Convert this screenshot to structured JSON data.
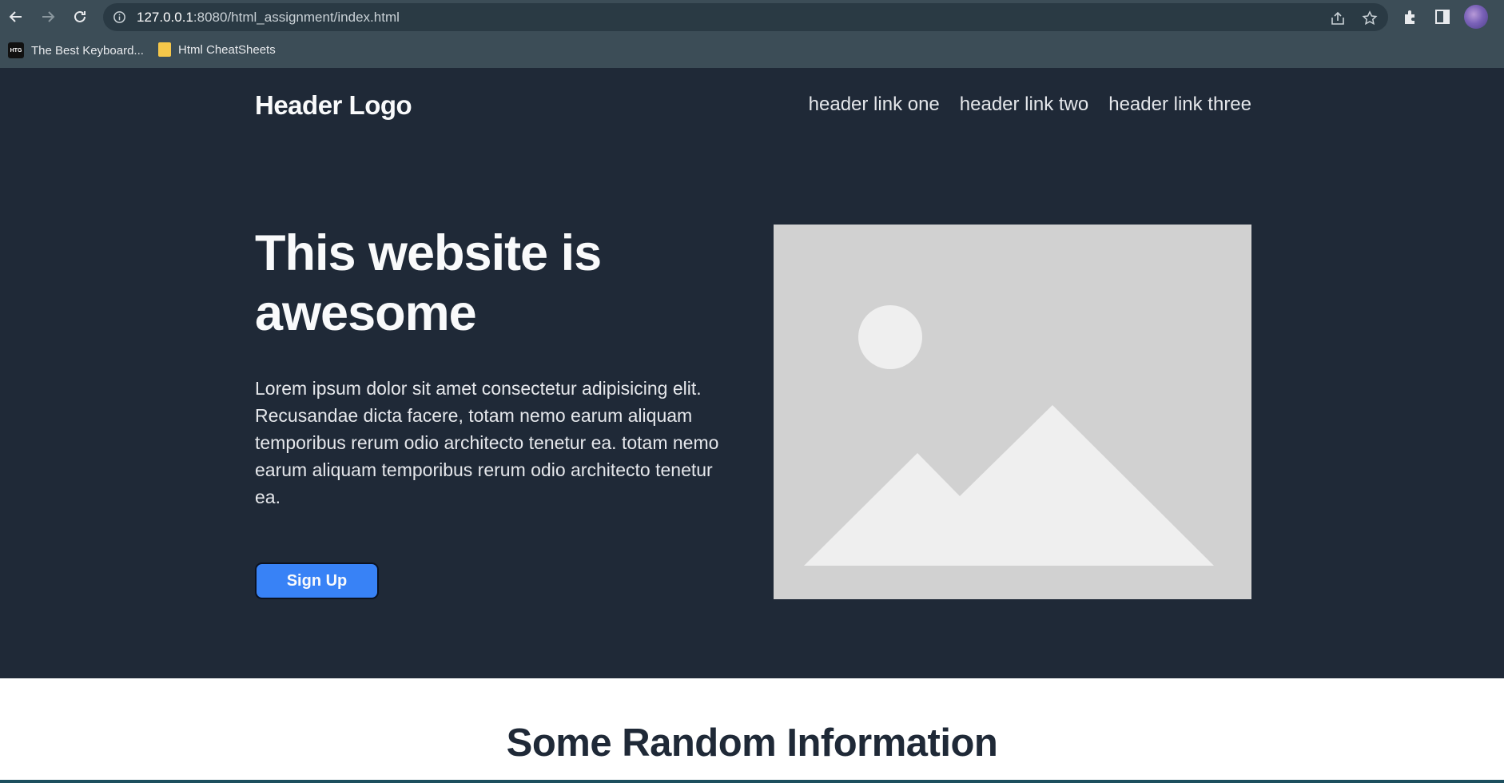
{
  "browser": {
    "url_host": "127.0.0.1",
    "url_path": ":8080/html_assignment/index.html",
    "bookmarks": [
      {
        "favicon_text": "HTG",
        "label": "The Best Keyboard..."
      },
      {
        "label": "Html CheatSheets"
      }
    ]
  },
  "header": {
    "logo": "Header Logo",
    "links": [
      "header link one",
      "header link two",
      "header link three"
    ]
  },
  "hero": {
    "title": "This website is awesome",
    "text": "Lorem ipsum dolor sit amet consectetur adipisicing elit. Recusandae dicta facere, totam nemo earum aliquam temporibus rerum odio architecto tenetur ea. totam nemo earum aliquam temporibus rerum odio architecto tenetur ea.",
    "button": "Sign Up"
  },
  "info": {
    "title": "Some Random Information"
  },
  "colors": {
    "hero_bg": "#1f2937",
    "button": "#3882f6",
    "chrome_bg": "#3c4d57"
  }
}
